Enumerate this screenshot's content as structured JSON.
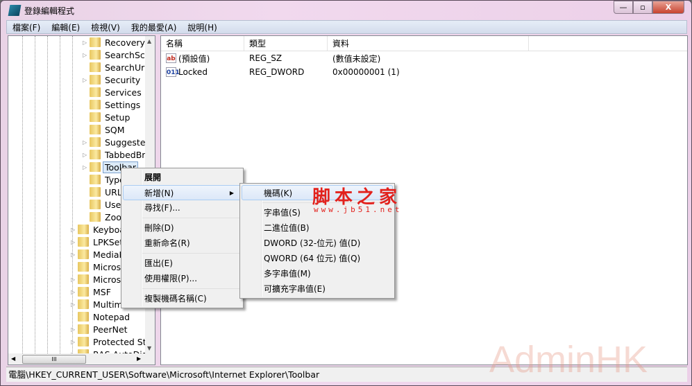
{
  "window": {
    "title": "登錄編輯程式",
    "minimize": "—",
    "maximize": "▫",
    "close": "X"
  },
  "menubar": [
    "檔案(F)",
    "編輯(E)",
    "檢視(V)",
    "我的最愛(A)",
    "說明(H)"
  ],
  "tree": {
    "level_a": [
      {
        "label": "Recovery",
        "expandable": true
      },
      {
        "label": "SearchScopes",
        "expandable": true
      },
      {
        "label": "SearchUrl",
        "expandable": false
      },
      {
        "label": "Security",
        "expandable": true
      },
      {
        "label": "Services",
        "expandable": false
      },
      {
        "label": "Settings",
        "expandable": false
      },
      {
        "label": "Setup",
        "expandable": false
      },
      {
        "label": "SQM",
        "expandable": false
      },
      {
        "label": "Suggested Sites",
        "expandable": true
      },
      {
        "label": "TabbedBrowsing",
        "expandable": true
      },
      {
        "label": "Toolbar",
        "expandable": true,
        "selected": true
      },
      {
        "label": "TypedURLs",
        "expandable": false
      },
      {
        "label": "URLSearchHooks",
        "expandable": false
      },
      {
        "label": "User Preferences",
        "expandable": false
      },
      {
        "label": "Zoom",
        "expandable": false
      }
    ],
    "level_b": [
      {
        "label": "Keyboard",
        "expandable": true
      },
      {
        "label": "LPKSetup",
        "expandable": true
      },
      {
        "label": "MediaPlayer",
        "expandable": true
      },
      {
        "label": "Microsoft",
        "expandable": false
      },
      {
        "label": "Microsoft",
        "expandable": true
      },
      {
        "label": "MSF",
        "expandable": true
      },
      {
        "label": "Multimedia",
        "expandable": true
      },
      {
        "label": "Notepad",
        "expandable": false
      },
      {
        "label": "PeerNet",
        "expandable": true
      },
      {
        "label": "Protected Storage",
        "expandable": true
      },
      {
        "label": "RAS AutoDial",
        "expandable": true
      }
    ],
    "hscroll_grip": "III"
  },
  "list": {
    "columns": [
      "名稱",
      "類型",
      "資料"
    ],
    "rows": [
      {
        "icon": "string-value-icon",
        "icon_text": "ab",
        "name": "(預設值)",
        "type": "REG_SZ",
        "data": "(數值未設定)"
      },
      {
        "icon": "binary-value-icon",
        "icon_text": "011",
        "name": "Locked",
        "type": "REG_DWORD",
        "data": "0x00000001 (1)"
      }
    ]
  },
  "context_menu": [
    {
      "label": "展開",
      "bold": true
    },
    {
      "label": "新增(N)",
      "submenu": true,
      "highlighted": true
    },
    {
      "label": "尋找(F)..."
    },
    {
      "sep": true
    },
    {
      "label": "刪除(D)"
    },
    {
      "label": "重新命名(R)"
    },
    {
      "sep": true
    },
    {
      "label": "匯出(E)"
    },
    {
      "label": "使用權限(P)..."
    },
    {
      "sep": true
    },
    {
      "label": "複製機碼名稱(C)"
    }
  ],
  "submenu": [
    {
      "label": "機碼(K)",
      "highlighted": true
    },
    {
      "sep": true
    },
    {
      "label": "字串值(S)"
    },
    {
      "label": "二進位值(B)"
    },
    {
      "label": "DWORD (32-位元) 值(D)"
    },
    {
      "label": "QWORD (64 位元) 值(Q)"
    },
    {
      "label": "多字串值(M)"
    },
    {
      "label": "可擴充字串值(E)"
    }
  ],
  "status_bar": "電腦\\HKEY_CURRENT_USER\\Software\\Microsoft\\Internet Explorer\\Toolbar",
  "watermarks": {
    "site_logo": "脚本之家",
    "site_url": "www.jb51.net",
    "overlay": "AdminHK"
  },
  "colors": {
    "selection": "#dceaf8",
    "close_button": "#c8432f",
    "watermark": "#e2211c"
  }
}
